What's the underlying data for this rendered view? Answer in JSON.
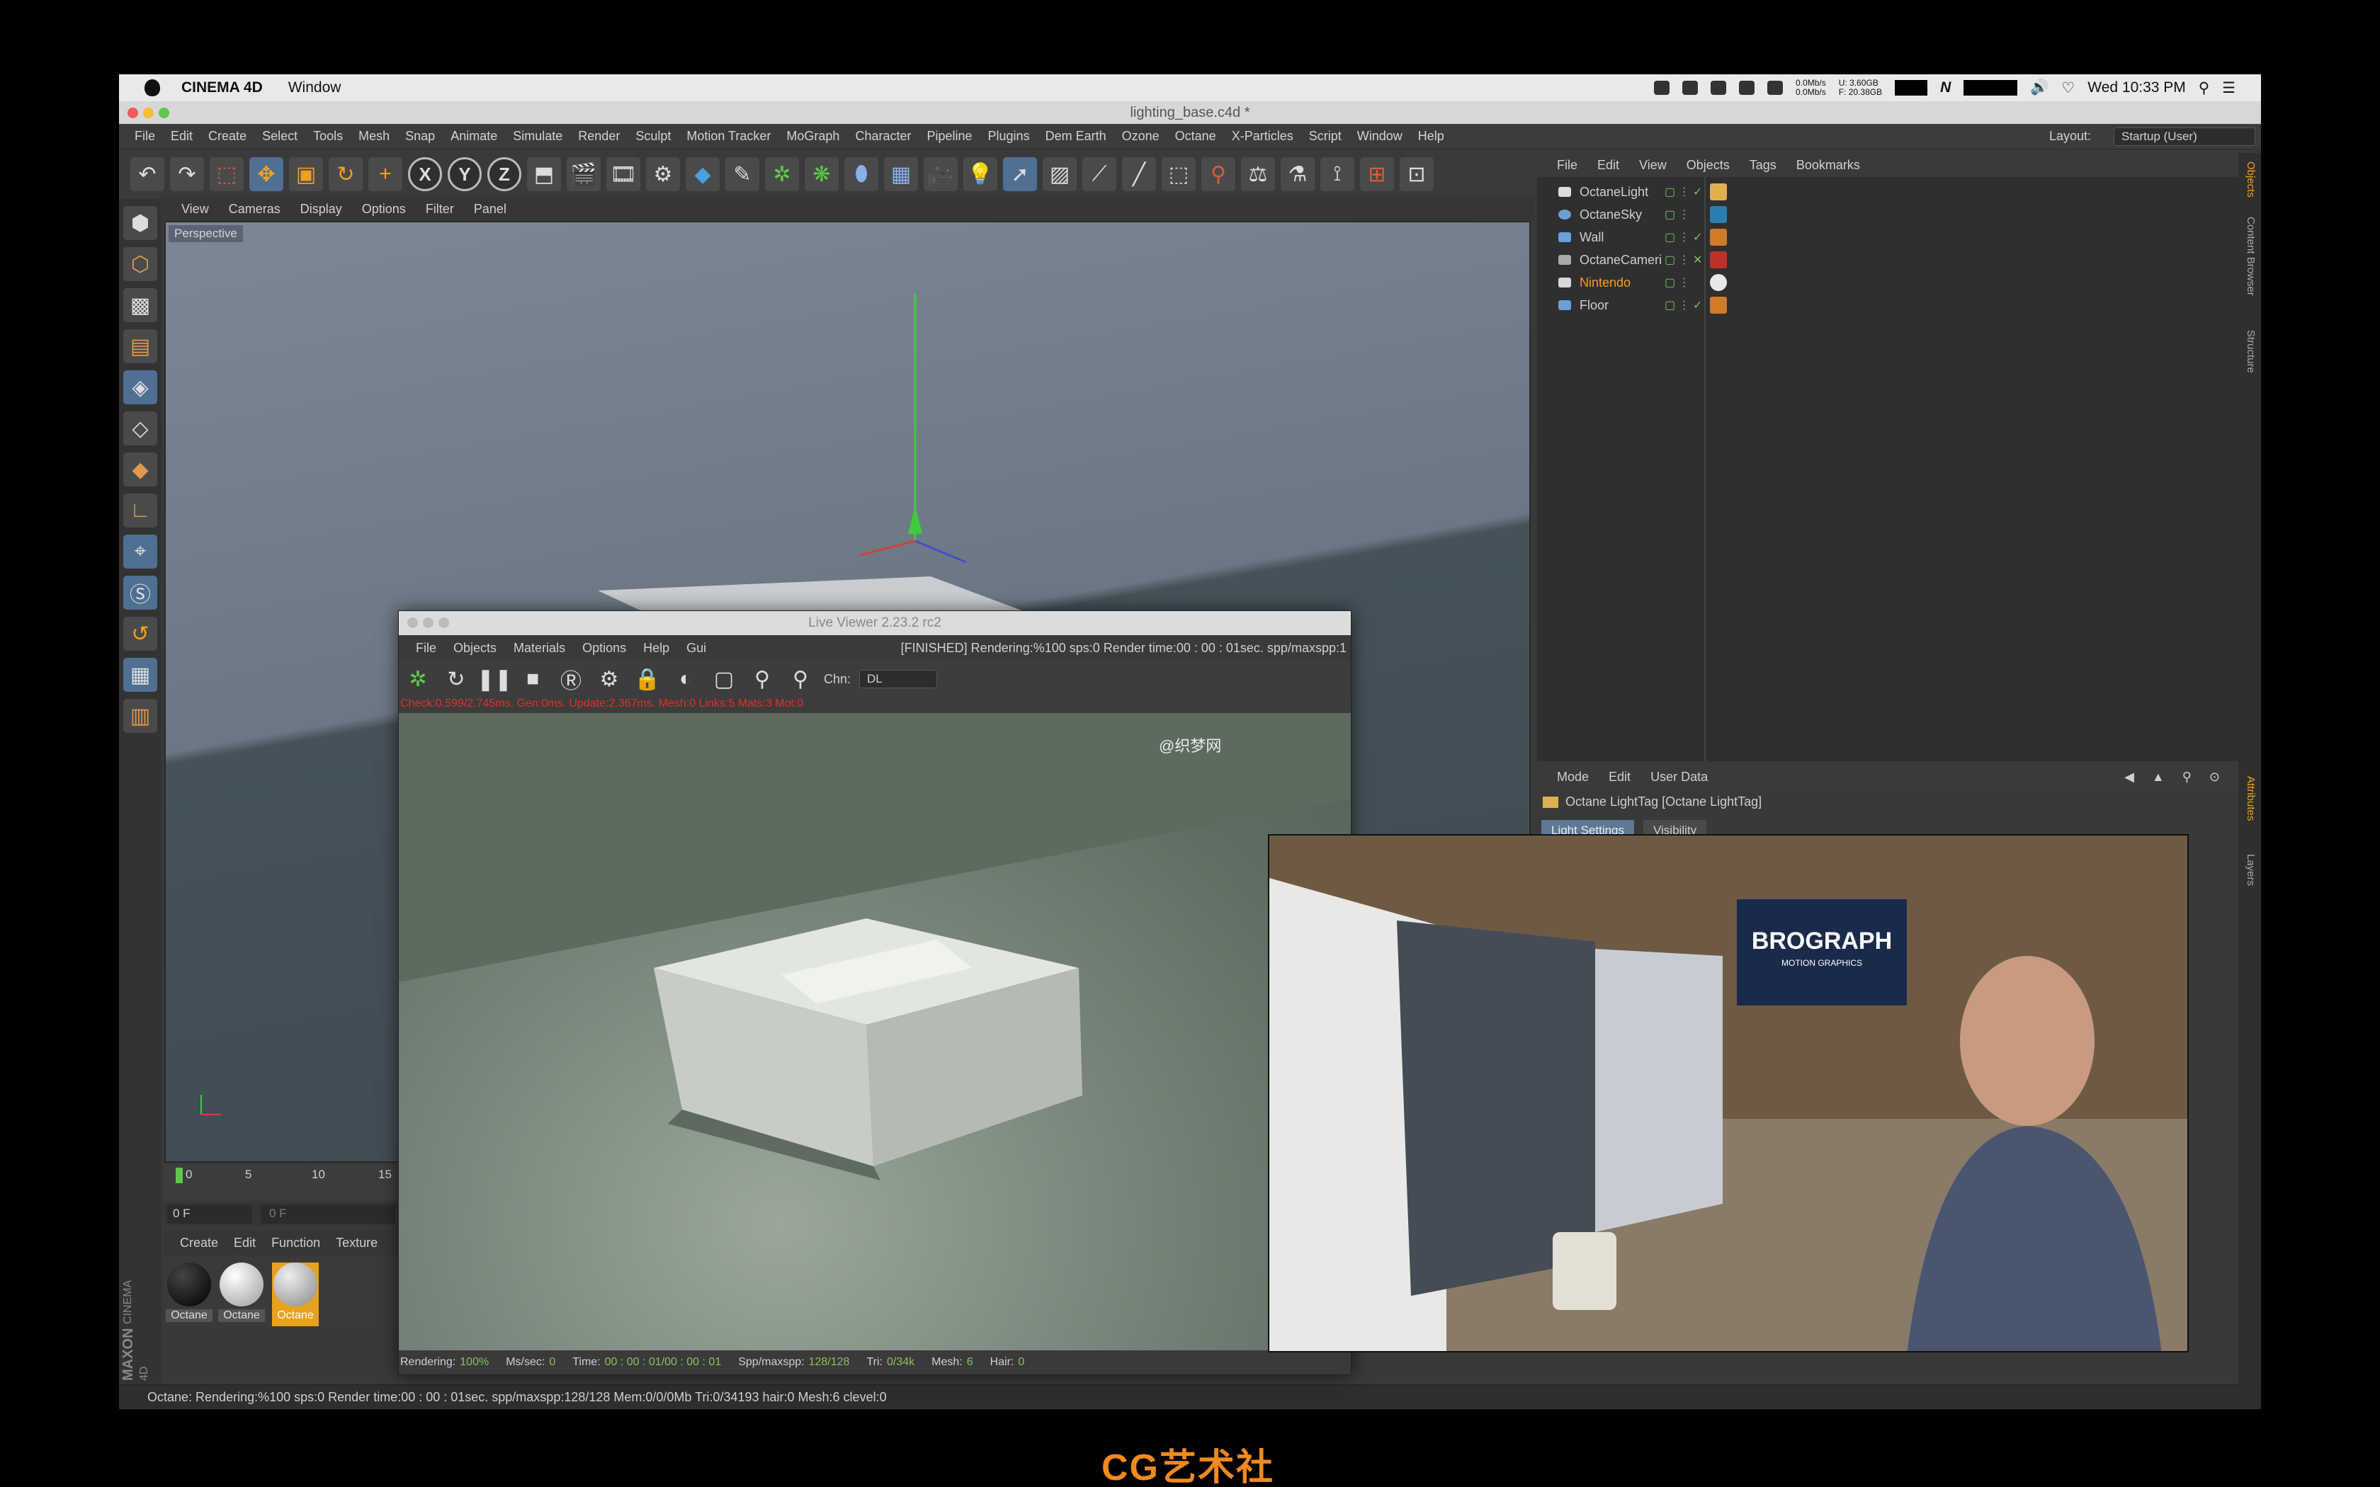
{
  "mac_menubar": {
    "app_name": "CINEMA 4D",
    "window_menu": "Window",
    "net_up": "0.0Mb/s",
    "net_down": "0.0Mb/s",
    "mem_u": "U: 3.60GB",
    "mem_f": "F: 20.38GB",
    "clock": "Wed 10:33 PM"
  },
  "window": {
    "title": "lighting_base.c4d *"
  },
  "menu": {
    "items": [
      "File",
      "Edit",
      "Create",
      "Select",
      "Tools",
      "Mesh",
      "Snap",
      "Animate",
      "Simulate",
      "Render",
      "Sculpt",
      "Motion Tracker",
      "MoGraph",
      "Character",
      "Pipeline",
      "Plugins",
      "Dem Earth",
      "Ozone",
      "Octane",
      "X-Particles",
      "Script",
      "Window",
      "Help"
    ],
    "layout_label": "Layout:",
    "layout_value": "Startup (User)"
  },
  "axis_tools": [
    "X",
    "Y",
    "Z"
  ],
  "viewport": {
    "menu": [
      "View",
      "Cameras",
      "Display",
      "Options",
      "Filter",
      "Panel"
    ],
    "label": "Perspective"
  },
  "timeline": {
    "ticks": [
      "0",
      "5",
      "10",
      "15"
    ],
    "frame_field": "0 F",
    "frame_field2": "0 F"
  },
  "material_manager": {
    "menu": [
      "Create",
      "Edit",
      "Function",
      "Texture"
    ],
    "materials": [
      {
        "name": "Octane",
        "selected": false,
        "color": "#050505"
      },
      {
        "name": "Octane",
        "selected": false,
        "color": "#e8e8e8"
      },
      {
        "name": "Octane",
        "selected": true,
        "color": "#cfcfcf"
      }
    ]
  },
  "branding": {
    "maxon": "MAXON",
    "c4d": "CINEMA 4D"
  },
  "status_bar": {
    "text": "Octane: Rendering:%100 sps:0 Render time:00 : 00 : 01sec. spp/maxspp:128/128 Mem:0/0/0Mb Tri:0/34193 hair:0 Mesh:6 clevel:0"
  },
  "object_manager": {
    "menu": [
      "File",
      "Edit",
      "View",
      "Objects",
      "Tags",
      "Bookmarks"
    ],
    "objects": [
      {
        "name": "OctaneLight",
        "highlight": false,
        "icon_color": "#dddddd",
        "tag_color": "#e0b050"
      },
      {
        "name": "OctaneSky",
        "highlight": false,
        "icon_color": "#6aa0d8",
        "tag_color": "#2a7fb0"
      },
      {
        "name": "Wall",
        "highlight": false,
        "icon_color": "#6aa0d8",
        "tag_color": "#d07a2a"
      },
      {
        "name": "OctaneCameri",
        "highlight": false,
        "icon_color": "#aaaaaa",
        "tag_color": "#c0302a"
      },
      {
        "name": "Nintendo",
        "highlight": true,
        "icon_color": "#d8d8d8",
        "tag_color": "#e8e8e8"
      },
      {
        "name": "Floor",
        "highlight": false,
        "icon_color": "#6aa0d8",
        "tag_color": "#d07a2a"
      }
    ]
  },
  "attributes": {
    "menu": [
      "Mode",
      "Edit",
      "User Data"
    ],
    "title": "Octane LightTag [Octane LightTag]",
    "tabs": [
      "Light Settings",
      "Visibility"
    ]
  },
  "right_tabs": [
    "Objects",
    "Content Browser",
    "Structure",
    "Attributes",
    "Layers"
  ],
  "live_viewer": {
    "title": "Live Viewer 2.23.2 rc2",
    "menu": [
      "File",
      "Objects",
      "Materials",
      "Options",
      "Help",
      "Gui"
    ],
    "status": "[FINISHED]  Rendering:%100 sps:0 Render time:00 : 00 : 01sec. spp/maxspp:1",
    "chn_label": "Chn:",
    "chn_value": "DL",
    "info": "Check:0.599/2.745ms. Gen:0ms. Update:2.367ms. Mesh:0 Links:5 Mats:3 Mot:0",
    "bottom": [
      {
        "label": "Rendering:",
        "value": "100%"
      },
      {
        "label": "Ms/sec:",
        "value": "0"
      },
      {
        "label": "Time:",
        "value": "00 : 00 : 01/00 : 00 : 01"
      },
      {
        "label": "Spp/maxspp:",
        "value": "128/128"
      },
      {
        "label": "Tri:",
        "value": "0/34k"
      },
      {
        "label": "Mesh:",
        "value": "6"
      },
      {
        "label": "Hair:",
        "value": "0"
      }
    ]
  },
  "watermark": "@织梦网",
  "webcam": {
    "poster_text": "BROGRAPH",
    "poster_sub": "MOTION GRAPHICS"
  },
  "footer_logo": "CG艺术社"
}
